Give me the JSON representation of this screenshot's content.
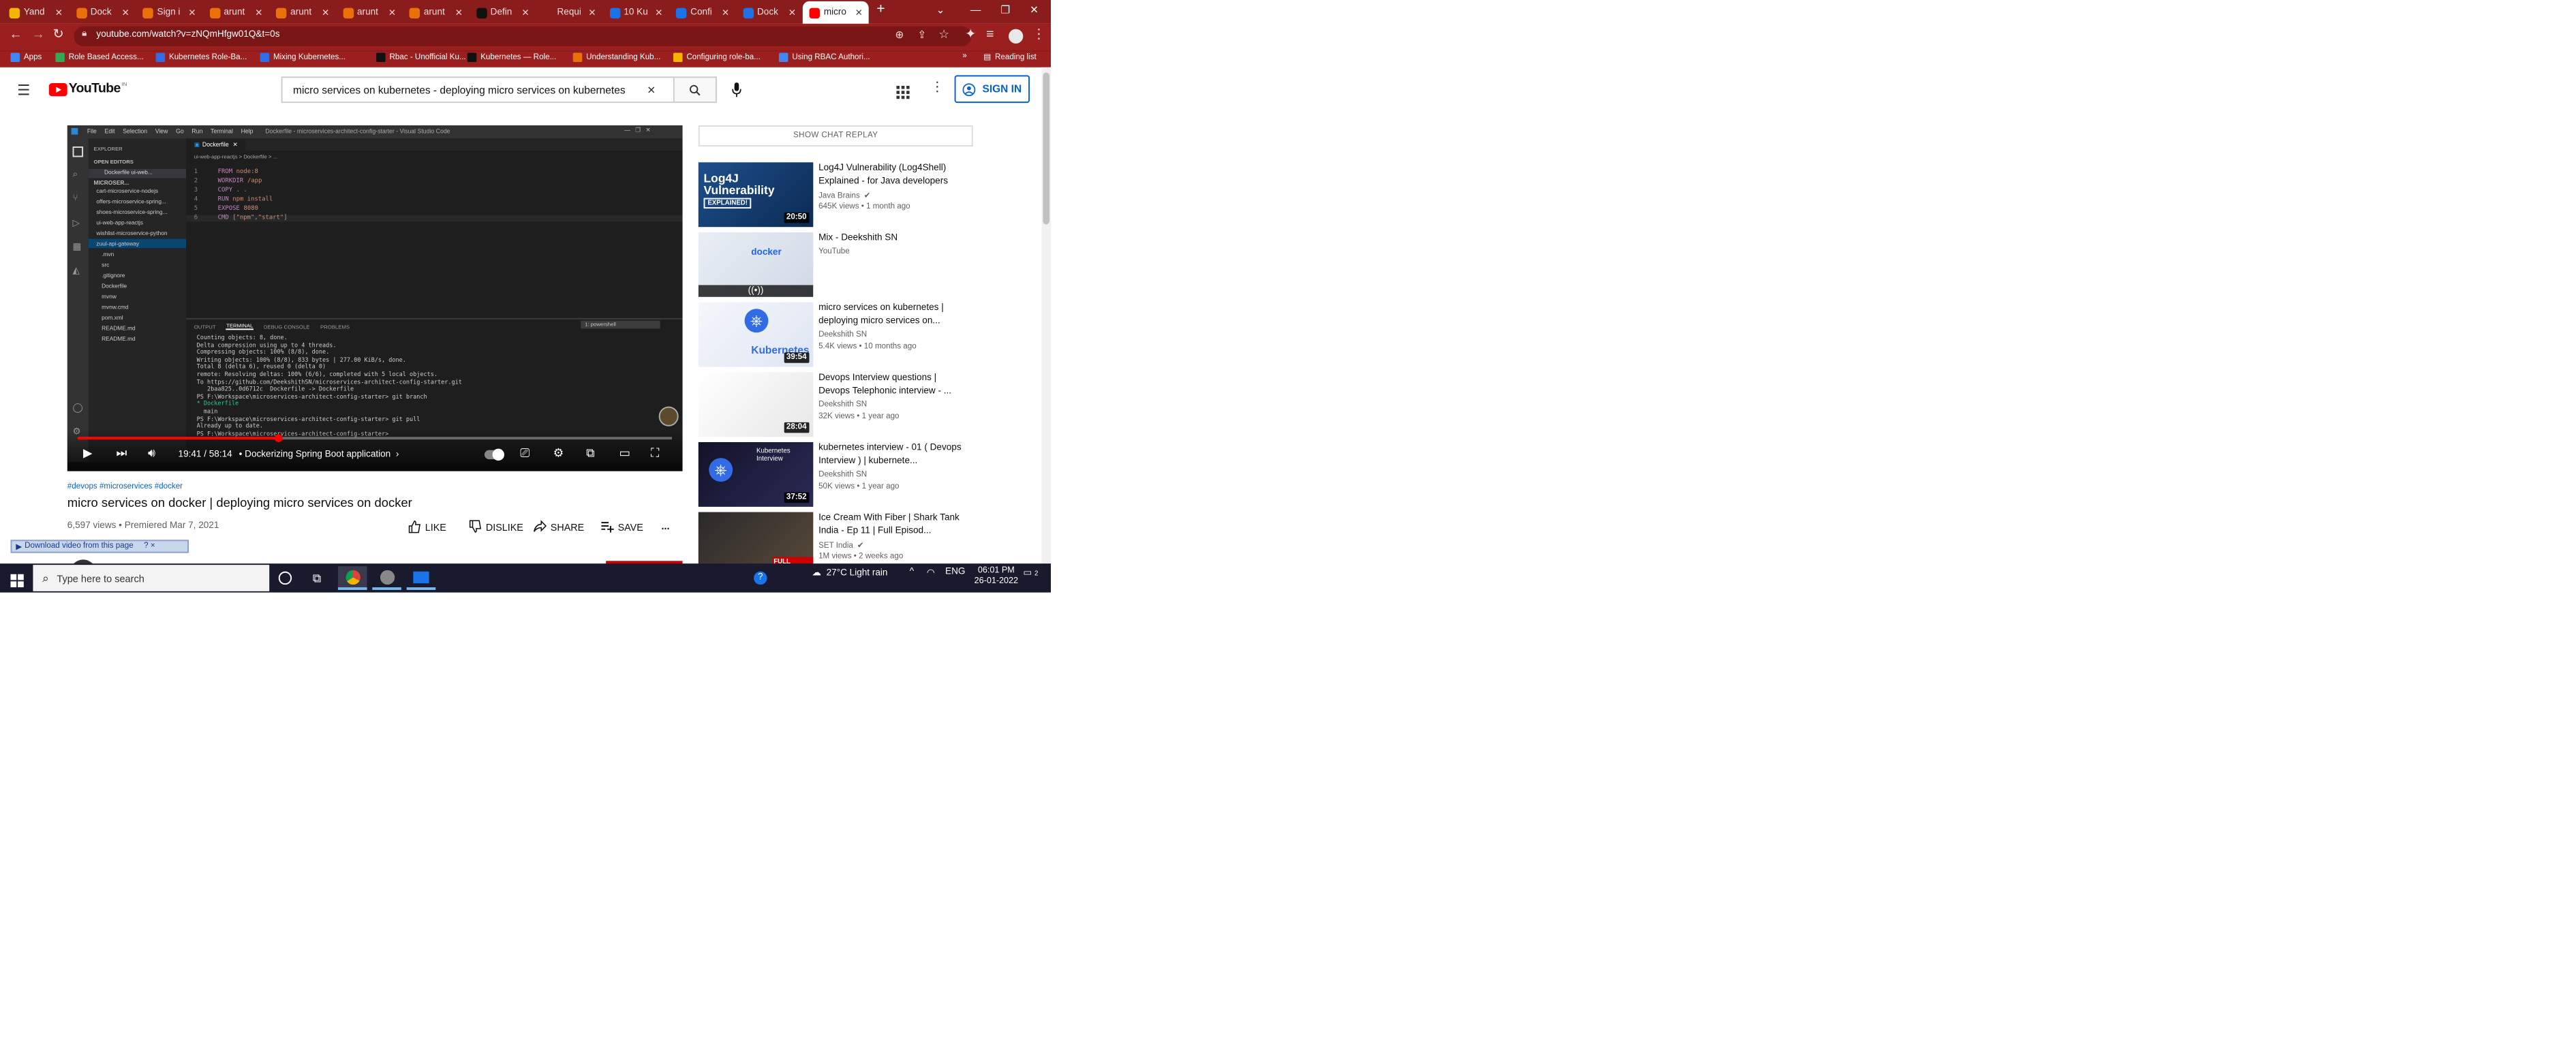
{
  "browser": {
    "tabs": [
      {
        "label": "Yand",
        "color": "#f4b400"
      },
      {
        "label": "Dock",
        "color": "#e8710a"
      },
      {
        "label": "Sign i",
        "color": "#e8710a"
      },
      {
        "label": "arunt",
        "color": "#e8710a"
      },
      {
        "label": "arunt",
        "color": "#e8710a"
      },
      {
        "label": "arunt",
        "color": "#e8710a"
      },
      {
        "label": "arunt",
        "color": "#e8710a"
      },
      {
        "label": "Defin",
        "color": "#111111"
      },
      {
        "label": "Requi",
        "color": "#8b1c1c"
      },
      {
        "label": "10 Ku",
        "color": "#1a73e8"
      },
      {
        "label": "Confi",
        "color": "#1a73e8"
      },
      {
        "label": "Dock",
        "color": "#1a73e8"
      },
      {
        "label": "micro",
        "color": "#ff0000"
      }
    ],
    "new_tab": "+",
    "url": "youtube.com/watch?v=zNQmHfgw01Q&t=0s",
    "bookmarks": [
      {
        "label": "Apps",
        "color": "#4285f4"
      },
      {
        "label": "Role Based Access...",
        "color": "#34a853"
      },
      {
        "label": "Kubernetes Role-Ba...",
        "color": "#326ce5"
      },
      {
        "label": "Mixing Kubernetes...",
        "color": "#326ce5"
      },
      {
        "label": "Rbac - Unofficial Ku...",
        "color": "#111111"
      },
      {
        "label": "Kubernetes — Role...",
        "color": "#111111"
      },
      {
        "label": "Understanding Kub...",
        "color": "#e8710a"
      },
      {
        "label": "Configuring role-ba...",
        "color": "#f4b400"
      },
      {
        "label": "Using RBAC Authori...",
        "color": "#4285f4"
      }
    ],
    "bookmarks_more": "»",
    "reading_list": "Reading list"
  },
  "youtube": {
    "logo_text": "YouTube",
    "logo_region": "IN",
    "search_value": "micro services on kubernetes - deploying micro services on kubernetes",
    "sign_in": "SIGN IN",
    "brand_color": "#ff0000",
    "link_color": "#065fd4"
  },
  "video": {
    "vscode": {
      "menu": [
        "File",
        "Edit",
        "Selection",
        "View",
        "Go",
        "Run",
        "Terminal",
        "Help"
      ],
      "title": "Dockerfile - microservices-architect-config-starter - Visual Studio Code",
      "explorer": "EXPLORER",
      "open_editors": "OPEN EDITORS",
      "open_file": "Dockerfile ui-web...",
      "project": "MICROSER...",
      "tree": [
        "cart-microservice-nodejs",
        "offers-microservice-spring...",
        "shoes-microservice-spring...",
        "ui-web-app-reactjs",
        "wishlist-microservice-python",
        "zuul-api-gateway",
        ".mvn",
        "src",
        ".gitignore",
        "Dockerfile",
        "mvnw",
        "mvnw.cmd",
        "pom.xml",
        "README.md",
        "README.md"
      ],
      "tab": "Dockerfile",
      "breadcrumb": "ui-web-app-reactjs > Dockerfile > ...",
      "code": [
        {
          "n": "1",
          "kw": "FROM",
          "rest": " node:8"
        },
        {
          "n": "2",
          "kw": "WORKDIR",
          "rest": " /app"
        },
        {
          "n": "3",
          "kw": "COPY",
          "rest": " . ."
        },
        {
          "n": "4",
          "kw": "RUN",
          "rest": " npm install"
        },
        {
          "n": "5",
          "kw": "EXPOSE",
          "rest": " 8080"
        },
        {
          "n": "6",
          "kw": "CMD",
          "rest": " [\"npm\",\"start\"]"
        }
      ],
      "panel_tabs": [
        "OUTPUT",
        "TERMINAL",
        "DEBUG CONSOLE",
        "PROBLEMS"
      ],
      "shell": "1: powershell",
      "terminal": [
        "Counting objects: 8, done.",
        "Delta compression using up to 4 threads.",
        "Compressing objects: 100% (8/8), done.",
        "Writing objects: 100% (8/8), 833 bytes | 277.00 KiB/s, done.",
        "Total 8 (delta 6), reused 0 (delta 0)",
        "remote: Resolving deltas: 100% (6/6), completed with 5 local objects.",
        "To https://github.com/DeekshithSN/microservices-architect-config-starter.git",
        "   2baa825..0d6712c  Dockerfile -> Dockerfile",
        "PS F:\\Workspace\\microservices-architect-config-starter> git branch",
        "* Dockerfile",
        "  main",
        "PS F:\\Workspace\\microservices-architect-config-starter> git pull",
        "Already up to date.",
        "PS F:\\Workspace\\microservices-architect-config-starter> "
      ]
    },
    "time": "19:41 / 58:14",
    "chapter": "• Dockerizing Spring Boot application",
    "progress": 0.338,
    "hashtags": "#devops #microservices #docker",
    "title": "micro services on docker | deploying micro services on docker",
    "meta": "6,597 views • Premiered Mar 7, 2021",
    "actions": {
      "like": "LIKE",
      "dislike": "DISLIKE",
      "share": "SHARE",
      "save": "SAVE",
      "more": "..."
    },
    "download_bar": "Download video from this page",
    "download_bar_extra": "? ×"
  },
  "sidebar": {
    "chat_replay": "SHOW CHAT REPLAY",
    "items": [
      {
        "title": "Log4J Vulnerability (Log4Shell) Explained - for Java developers",
        "channel": "Java Brains",
        "verified": true,
        "views": "645K views • 1 month ago",
        "duration": "20:50",
        "thumb_text": "Log4J Vulnerability",
        "thumb_badge": "EXPLAINED!"
      },
      {
        "title": "Mix - Deekshith SN",
        "channel": "YouTube",
        "verified": false,
        "views": "",
        "duration": "",
        "thumb_text": "docker"
      },
      {
        "title": "micro services on kubernetes | deploying micro services on...",
        "channel": "Deekshith SN",
        "verified": false,
        "views": "5.4K views • 10 months ago",
        "duration": "39:54",
        "thumb_text": "Kubernetes"
      },
      {
        "title": "Devops Interview questions | Devops Telephonic interview - ...",
        "channel": "Deekshith SN",
        "verified": false,
        "views": "32K views • 1 year ago",
        "duration": "28:04",
        "thumb_text": ""
      },
      {
        "title": "kubernetes interview - 01 ( Devops Interview ) | kubernete...",
        "channel": "Deekshith SN",
        "verified": false,
        "views": "50K views • 1 year ago",
        "duration": "37:52",
        "thumb_text": "Kubernetes Interview"
      },
      {
        "title": "Ice Cream With Fiber | Shark Tank India - Ep 11 | Full Episod...",
        "channel": "SET India",
        "verified": true,
        "views": "1M views • 2 weeks ago",
        "duration": "",
        "thumb_text": "FULL EPISODE"
      }
    ]
  },
  "taskbar": {
    "search_placeholder": "Type here to search",
    "weather": "27°C  Light rain",
    "lang": "ENG",
    "time": "06:01 PM",
    "date": "26-01-2022",
    "notifications": "2"
  }
}
